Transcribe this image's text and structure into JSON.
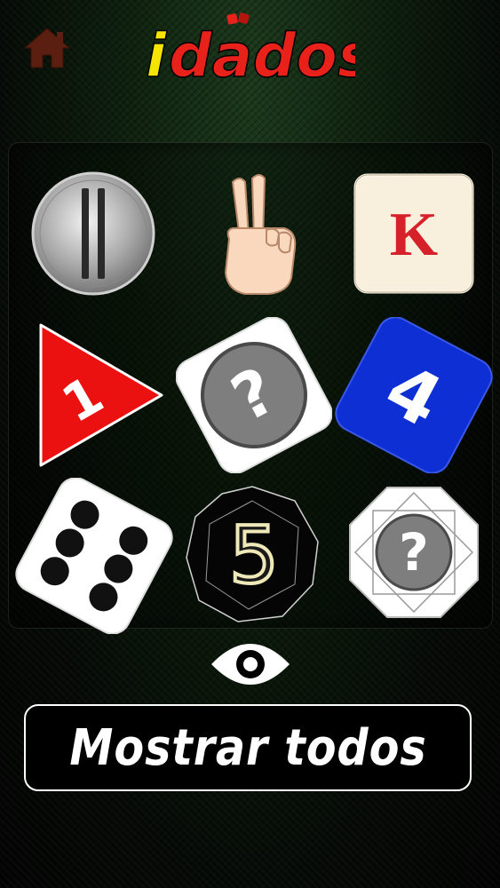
{
  "header": {
    "home_icon": "home-icon",
    "logo": {
      "letter_i": "i",
      "rest": "dados",
      "colors": {
        "i": "#f5e400",
        "dados": "#e8221b"
      }
    }
  },
  "dice": [
    {
      "name": "coin-die",
      "face": "||"
    },
    {
      "name": "hand-die",
      "face": "victory-hand"
    },
    {
      "name": "card-die",
      "face": "K"
    },
    {
      "name": "triangle-die",
      "face": "1"
    },
    {
      "name": "white-cube-die-unknown",
      "face": "?"
    },
    {
      "name": "blue-cube-die",
      "face": "4"
    },
    {
      "name": "pip-die",
      "face": "6-pips"
    },
    {
      "name": "black-d12-die",
      "face": "5"
    },
    {
      "name": "octagon-die-unknown",
      "face": "?"
    }
  ],
  "eye_icon": "eye-icon",
  "show_all": {
    "label": "Mostrar todos"
  }
}
